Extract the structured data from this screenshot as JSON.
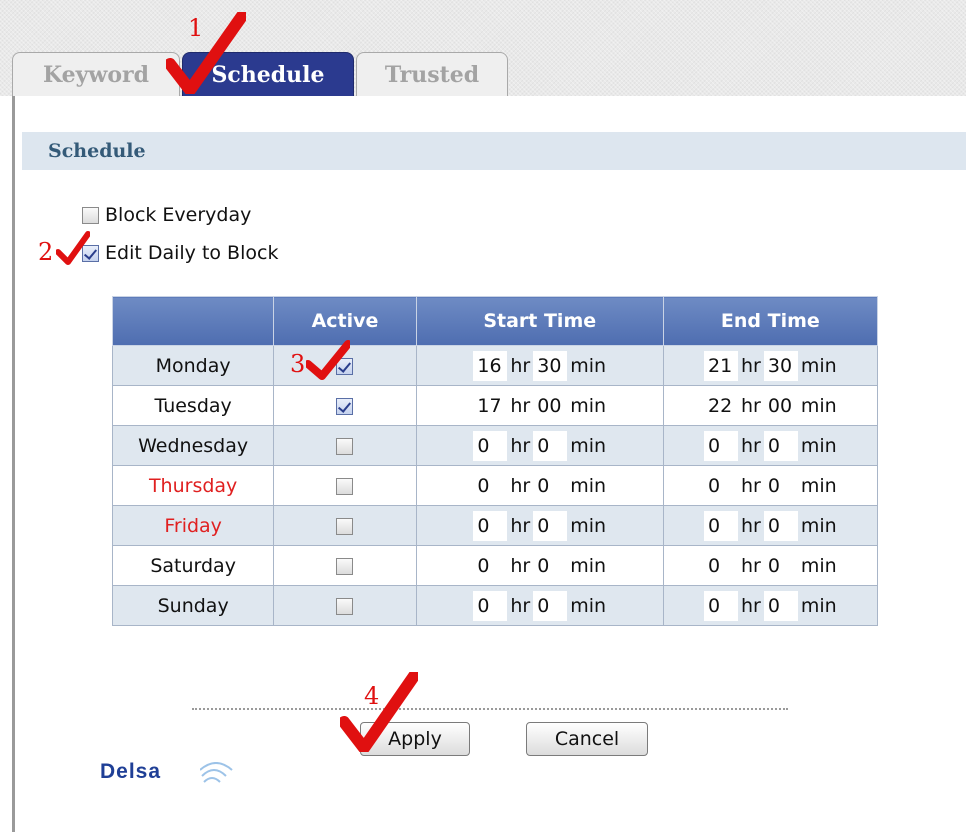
{
  "tabs": [
    {
      "label": "Keyword",
      "active": false
    },
    {
      "label": "Schedule",
      "active": true
    },
    {
      "label": "Trusted",
      "active": false
    }
  ],
  "section_title": "Schedule",
  "options": {
    "block_everyday": {
      "label": "Block Everyday",
      "checked": false
    },
    "edit_daily": {
      "label": "Edit Daily to Block",
      "checked": true
    }
  },
  "table": {
    "headers": [
      "",
      "Active",
      "Start Time",
      "End Time"
    ],
    "hr_unit": "hr",
    "min_unit": "min",
    "rows": [
      {
        "day": "Monday",
        "active": true,
        "start_hr": "16",
        "start_min": "30",
        "end_hr": "21",
        "end_min": "30"
      },
      {
        "day": "Tuesday",
        "active": true,
        "start_hr": "17",
        "start_min": "00",
        "end_hr": "22",
        "end_min": "00"
      },
      {
        "day": "Wednesday",
        "active": false,
        "start_hr": "0",
        "start_min": "0",
        "end_hr": "0",
        "end_min": "0"
      },
      {
        "day": "Thursday",
        "active": false,
        "start_hr": "0",
        "start_min": "0",
        "end_hr": "0",
        "end_min": "0"
      },
      {
        "day": "Friday",
        "active": false,
        "start_hr": "0",
        "start_min": "0",
        "end_hr": "0",
        "end_min": "0"
      },
      {
        "day": "Saturday",
        "active": false,
        "start_hr": "0",
        "start_min": "0",
        "end_hr": "0",
        "end_min": "0"
      },
      {
        "day": "Sunday",
        "active": false,
        "start_hr": "0",
        "start_min": "0",
        "end_hr": "0",
        "end_min": "0"
      }
    ]
  },
  "buttons": {
    "apply": "Apply",
    "cancel": "Cancel"
  },
  "logo": "Delsa",
  "annotations": [
    "1",
    "2",
    "3",
    "4"
  ],
  "colors": {
    "tab_active": "#2b3a8f",
    "header": "#5674b6",
    "weekend_day": "#e02020",
    "annotation": "#e01010"
  },
  "icons": {
    "check": "red-checkmark-icon",
    "logo": "delsa-logo"
  }
}
